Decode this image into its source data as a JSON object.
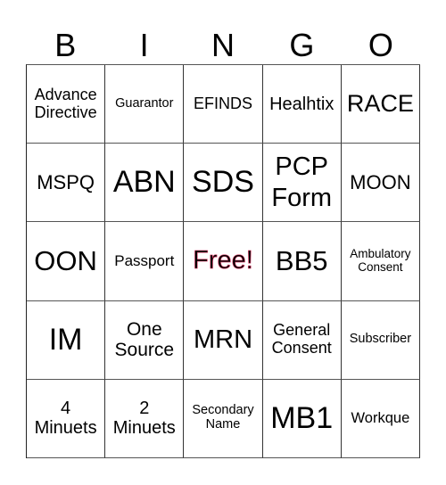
{
  "header": {
    "letters": [
      "B",
      "I",
      "N",
      "G",
      "O"
    ]
  },
  "colors": {
    "free_outline": "#d63a63",
    "grid_line": "#444444"
  },
  "grid": {
    "rows": [
      [
        "Advance Directive",
        "Guarantor",
        "EFINDS",
        "Healhtix",
        "RACE"
      ],
      [
        "MSPQ",
        "ABN",
        "SDS",
        "PCP Form",
        "MOON"
      ],
      [
        "OON",
        "Passport",
        "Free!",
        "BB5",
        "Ambulatory Consent"
      ],
      [
        "IM",
        "One Source",
        "MRN",
        "General Consent",
        "Subscriber"
      ],
      [
        "4 Minuets",
        "2 Minuets",
        "Secondary Name",
        "MB1",
        "Workque"
      ]
    ]
  }
}
